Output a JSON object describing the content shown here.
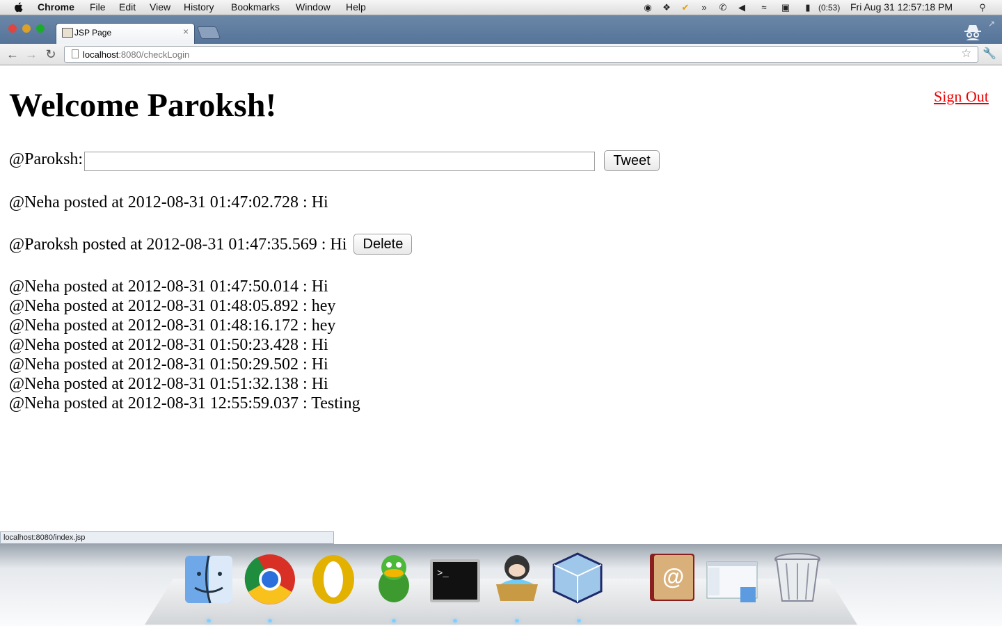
{
  "menubar": {
    "app_name": "Chrome",
    "menus": [
      "File",
      "Edit",
      "View",
      "History",
      "Bookmarks",
      "Window",
      "Help"
    ],
    "battery_text": "(0:53)",
    "clock": "Fri Aug 31  12:57:18 PM"
  },
  "browser": {
    "tab_title": "JSP Page",
    "url_host": "localhost",
    "url_rest": ":8080/checkLogin",
    "status_url": "localhost:8080/index.jsp"
  },
  "page": {
    "heading": "Welcome Paroksh!",
    "sign_out": "Sign Out",
    "tweet_label": "@Paroksh:",
    "tweet_value": "",
    "tweet_button": "Tweet",
    "delete_button": "Delete",
    "posts": [
      "@Neha posted at 2012-08-31 01:47:02.728 : Hi",
      "@Paroksh posted at 2012-08-31 01:47:35.569 : Hi",
      "@Neha posted at 2012-08-31 01:47:50.014 : Hi",
      "@Neha posted at 2012-08-31 01:48:05.892 : hey",
      "@Neha posted at 2012-08-31 01:48:16.172 : hey",
      "@Neha posted at 2012-08-31 01:50:23.428 : Hi",
      "@Neha posted at 2012-08-31 01:50:29.502 : Hi",
      "@Neha posted at 2012-08-31 01:51:32.138 : Hi",
      "@Neha posted at 2012-08-31 12:55:59.037 : Testing"
    ]
  },
  "dock": {
    "apps": [
      "finder-icon",
      "chrome-icon",
      "opera-icon",
      "adium-icon",
      "terminal-icon",
      "github-icon",
      "virtualbox-icon",
      "address-book-icon",
      "preview-window-icon",
      "trash-icon"
    ]
  },
  "colors": {
    "link": "#e00000",
    "chrome_frame": "#55749a"
  }
}
